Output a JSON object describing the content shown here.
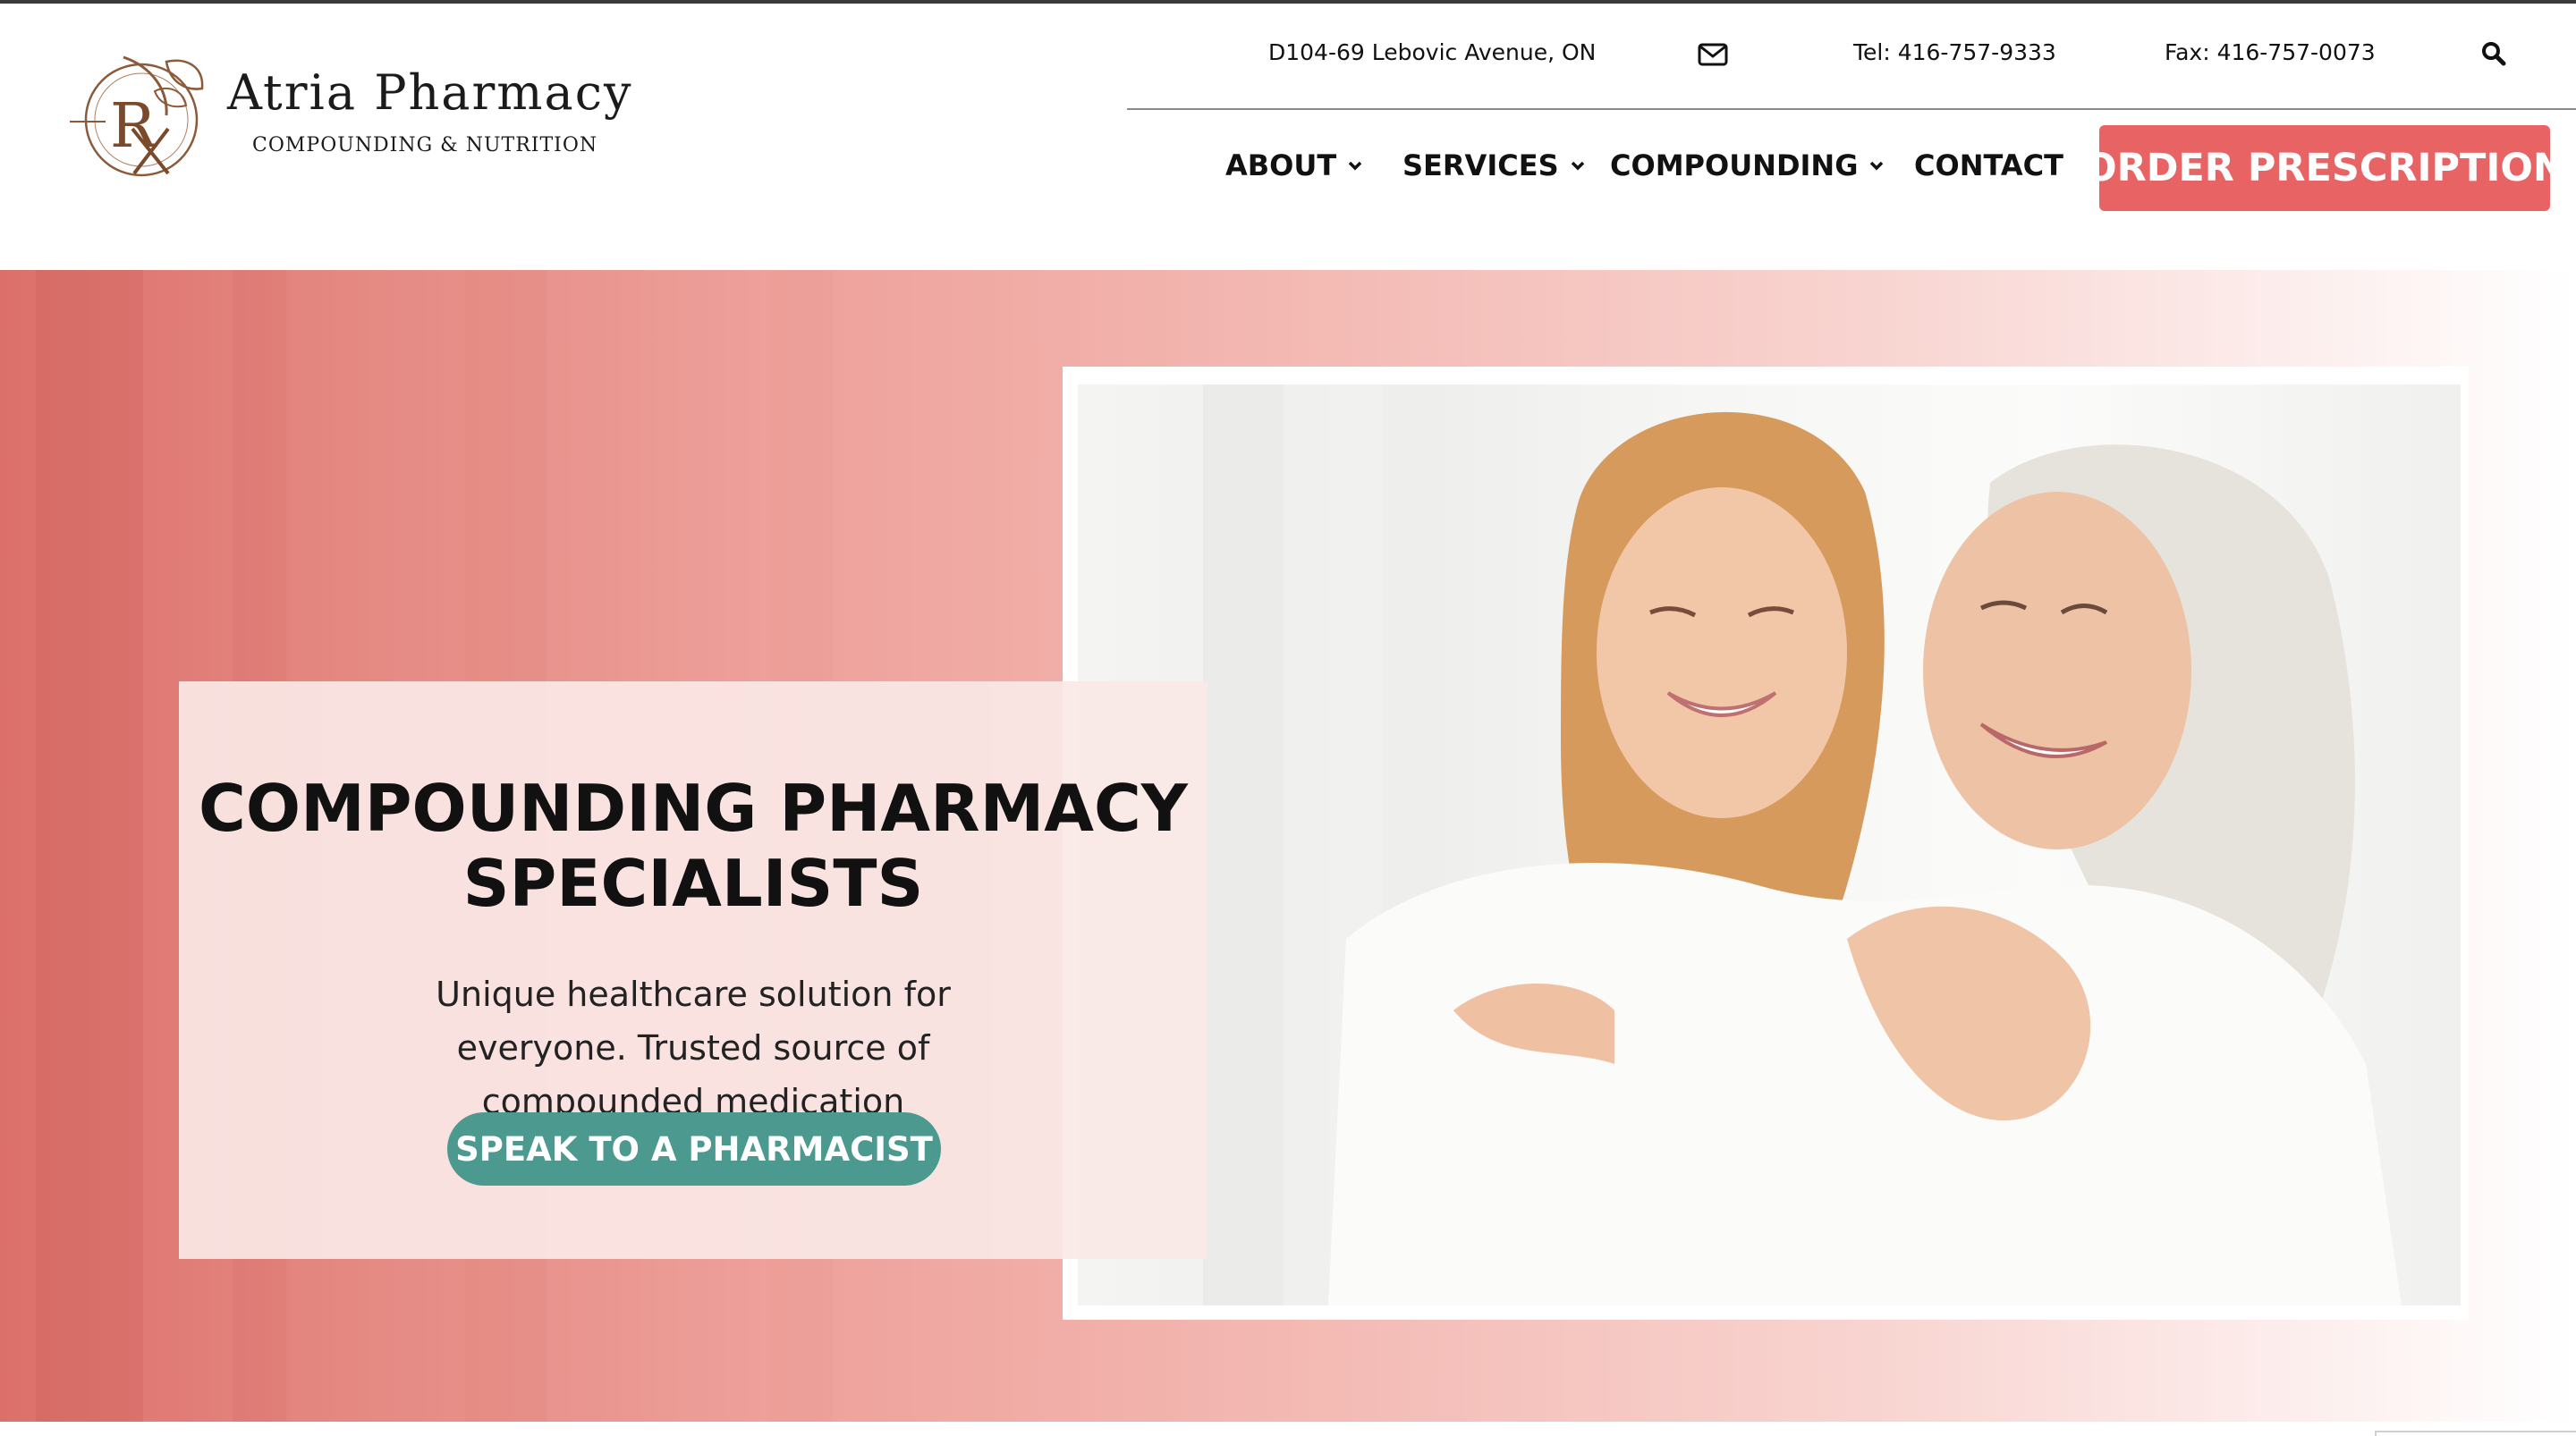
{
  "brand": {
    "name": "Atria Pharmacy",
    "tagline": "Compounding & Nutrition",
    "logo_icon": "rx-leaf-logo-icon",
    "accent_color": "#e86464",
    "button_color": "#4c9a8f"
  },
  "contact": {
    "address": "D104-69 Lebovic Avenue, ON",
    "email_icon": "envelope-icon",
    "tel": "Tel: 416-757-9333",
    "fax": "Fax: 416-757-0073",
    "search_icon": "search-icon"
  },
  "nav": {
    "items": [
      {
        "label": "ABOUT",
        "has_dropdown": true
      },
      {
        "label": "SERVICES",
        "has_dropdown": true
      },
      {
        "label": "COMPOUNDING",
        "has_dropdown": true
      },
      {
        "label": "CONTACT",
        "has_dropdown": false
      }
    ],
    "cta_label": "ORDER PRESCRIPTION"
  },
  "hero": {
    "title": "COMPOUNDING PHARMACY SPECIALISTS",
    "text": "Unique healthcare solution for everyone. Trusted source of compounded medication",
    "button_label": "SPEAK TO A PHARMACIST"
  }
}
